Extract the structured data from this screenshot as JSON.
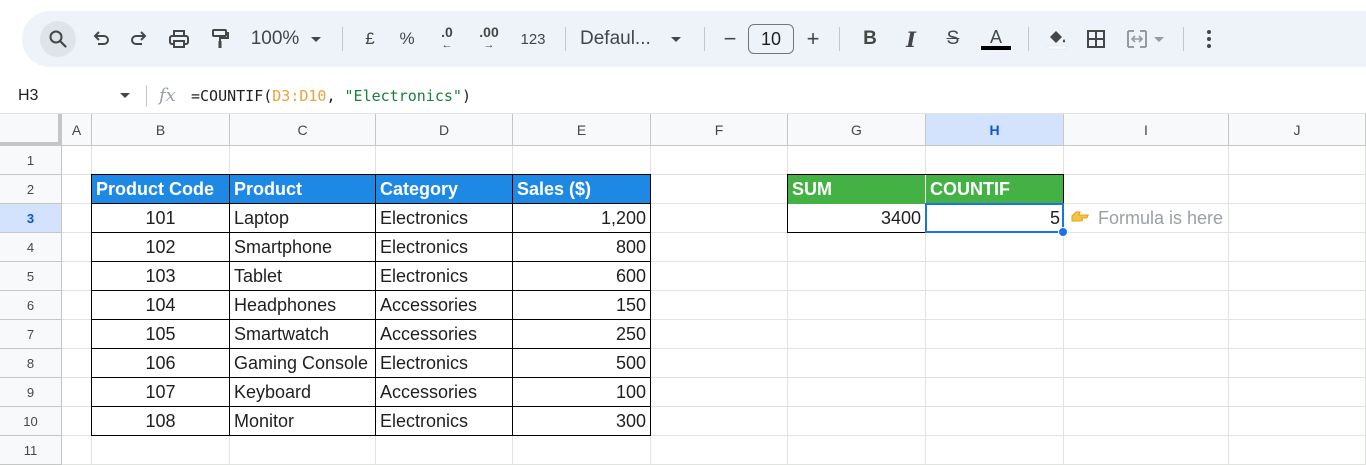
{
  "toolbar": {
    "zoom": "100%",
    "currency": "£",
    "percent": "%",
    "dec_decrease": ".0",
    "dec_increase": ".00",
    "number_format": "123",
    "font": "Defaul...",
    "font_size": "10",
    "minus": "−",
    "plus": "+",
    "bold": "B",
    "italic": "I",
    "strike": "S",
    "text_color_letter": "A",
    "text_color": "#000000",
    "icons": [
      "search-icon",
      "undo-icon",
      "redo-icon",
      "print-icon",
      "paint-format-icon",
      "fill-color-icon",
      "borders-icon",
      "merge-cells-icon",
      "more-vert-icon"
    ]
  },
  "formula_bar": {
    "cell_ref": "H3",
    "fx": "fx",
    "formula_prefix": "=COUNTIF(",
    "formula_range": "D3:D10",
    "formula_sep": ", ",
    "formula_string": "\"Electronics\"",
    "formula_suffix": ")"
  },
  "columns": [
    "A",
    "B",
    "C",
    "D",
    "E",
    "F",
    "G",
    "H",
    "I",
    "J"
  ],
  "rows": [
    "1",
    "2",
    "3",
    "4",
    "5",
    "6",
    "7",
    "8",
    "9",
    "10",
    "11"
  ],
  "active_cell": {
    "column": "H",
    "row": "3"
  },
  "table": {
    "headers": [
      "Product Code",
      "Product",
      "Category",
      "Sales ($)"
    ],
    "rows": [
      [
        "101",
        "Laptop",
        "Electronics",
        "1,200"
      ],
      [
        "102",
        "Smartphone",
        "Electronics",
        "800"
      ],
      [
        "103",
        "Tablet",
        "Electronics",
        "600"
      ],
      [
        "104",
        "Headphones",
        "Accessories",
        "150"
      ],
      [
        "105",
        "Smartwatch",
        "Accessories",
        "250"
      ],
      [
        "106",
        "Gaming Console",
        "Electronics",
        "500"
      ],
      [
        "107",
        "Keyboard",
        "Accessories",
        "100"
      ],
      [
        "108",
        "Monitor",
        "Electronics",
        "300"
      ]
    ]
  },
  "summary": {
    "sum_label": "SUM",
    "countif_label": "COUNTIF",
    "sum_value": "3400",
    "countif_value": "5"
  },
  "note": {
    "icon": "pointing-hand-icon",
    "text": "Formula is here"
  },
  "colors": {
    "header_blue": "#1e88e5",
    "header_green": "#43b144",
    "selection": "#1a73e8",
    "formula_range": "#e8a33d",
    "formula_string": "#188038"
  }
}
